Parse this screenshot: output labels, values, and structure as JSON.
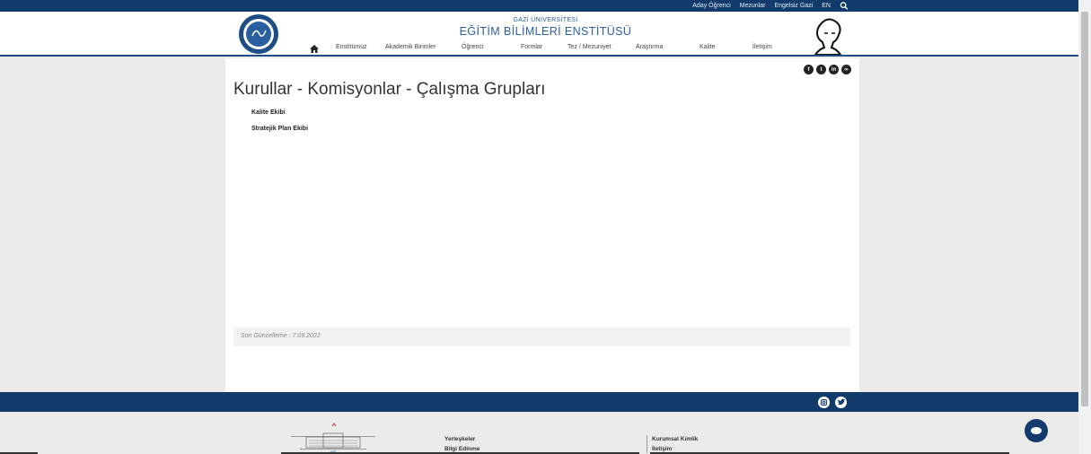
{
  "topbar": {
    "links": [
      "Aday Öğrenci",
      "Mezunlar",
      "Engelsiz Gazi",
      "EN"
    ]
  },
  "header": {
    "tagline": "GAZİ ÜNİVERSİTESİ",
    "title": "EĞİTİM BİLİMLERİ ENSTİTÜSÜ",
    "nav": [
      "Enstitümüz",
      "Akademik Birimler",
      "Öğrenci",
      "Formlar",
      "Tez / Mezuniyet",
      "Araştırma",
      "Kalite",
      "İletişim"
    ]
  },
  "main": {
    "heading": "Kurullar - Komisyonlar - Çalışma Grupları",
    "links": [
      "Kalite Ekibi",
      "Stratejik Plan Ekibi"
    ],
    "last_update": "Son Güncelleme : 7.09.2022",
    "share_icons": [
      "facebook-icon",
      "twitter-icon",
      "linkedin-icon",
      "link-icon"
    ]
  },
  "footer": {
    "col1": [
      "Yerleşkeler",
      "Bilgi Edinme"
    ],
    "col2": [
      "Kurumsal Kimlik",
      "İletişim"
    ],
    "social_icons": [
      "instagram-icon",
      "twitter-icon"
    ]
  },
  "colors": {
    "brand_navy": "#123b6c",
    "title_blue": "#2a5fa0"
  }
}
